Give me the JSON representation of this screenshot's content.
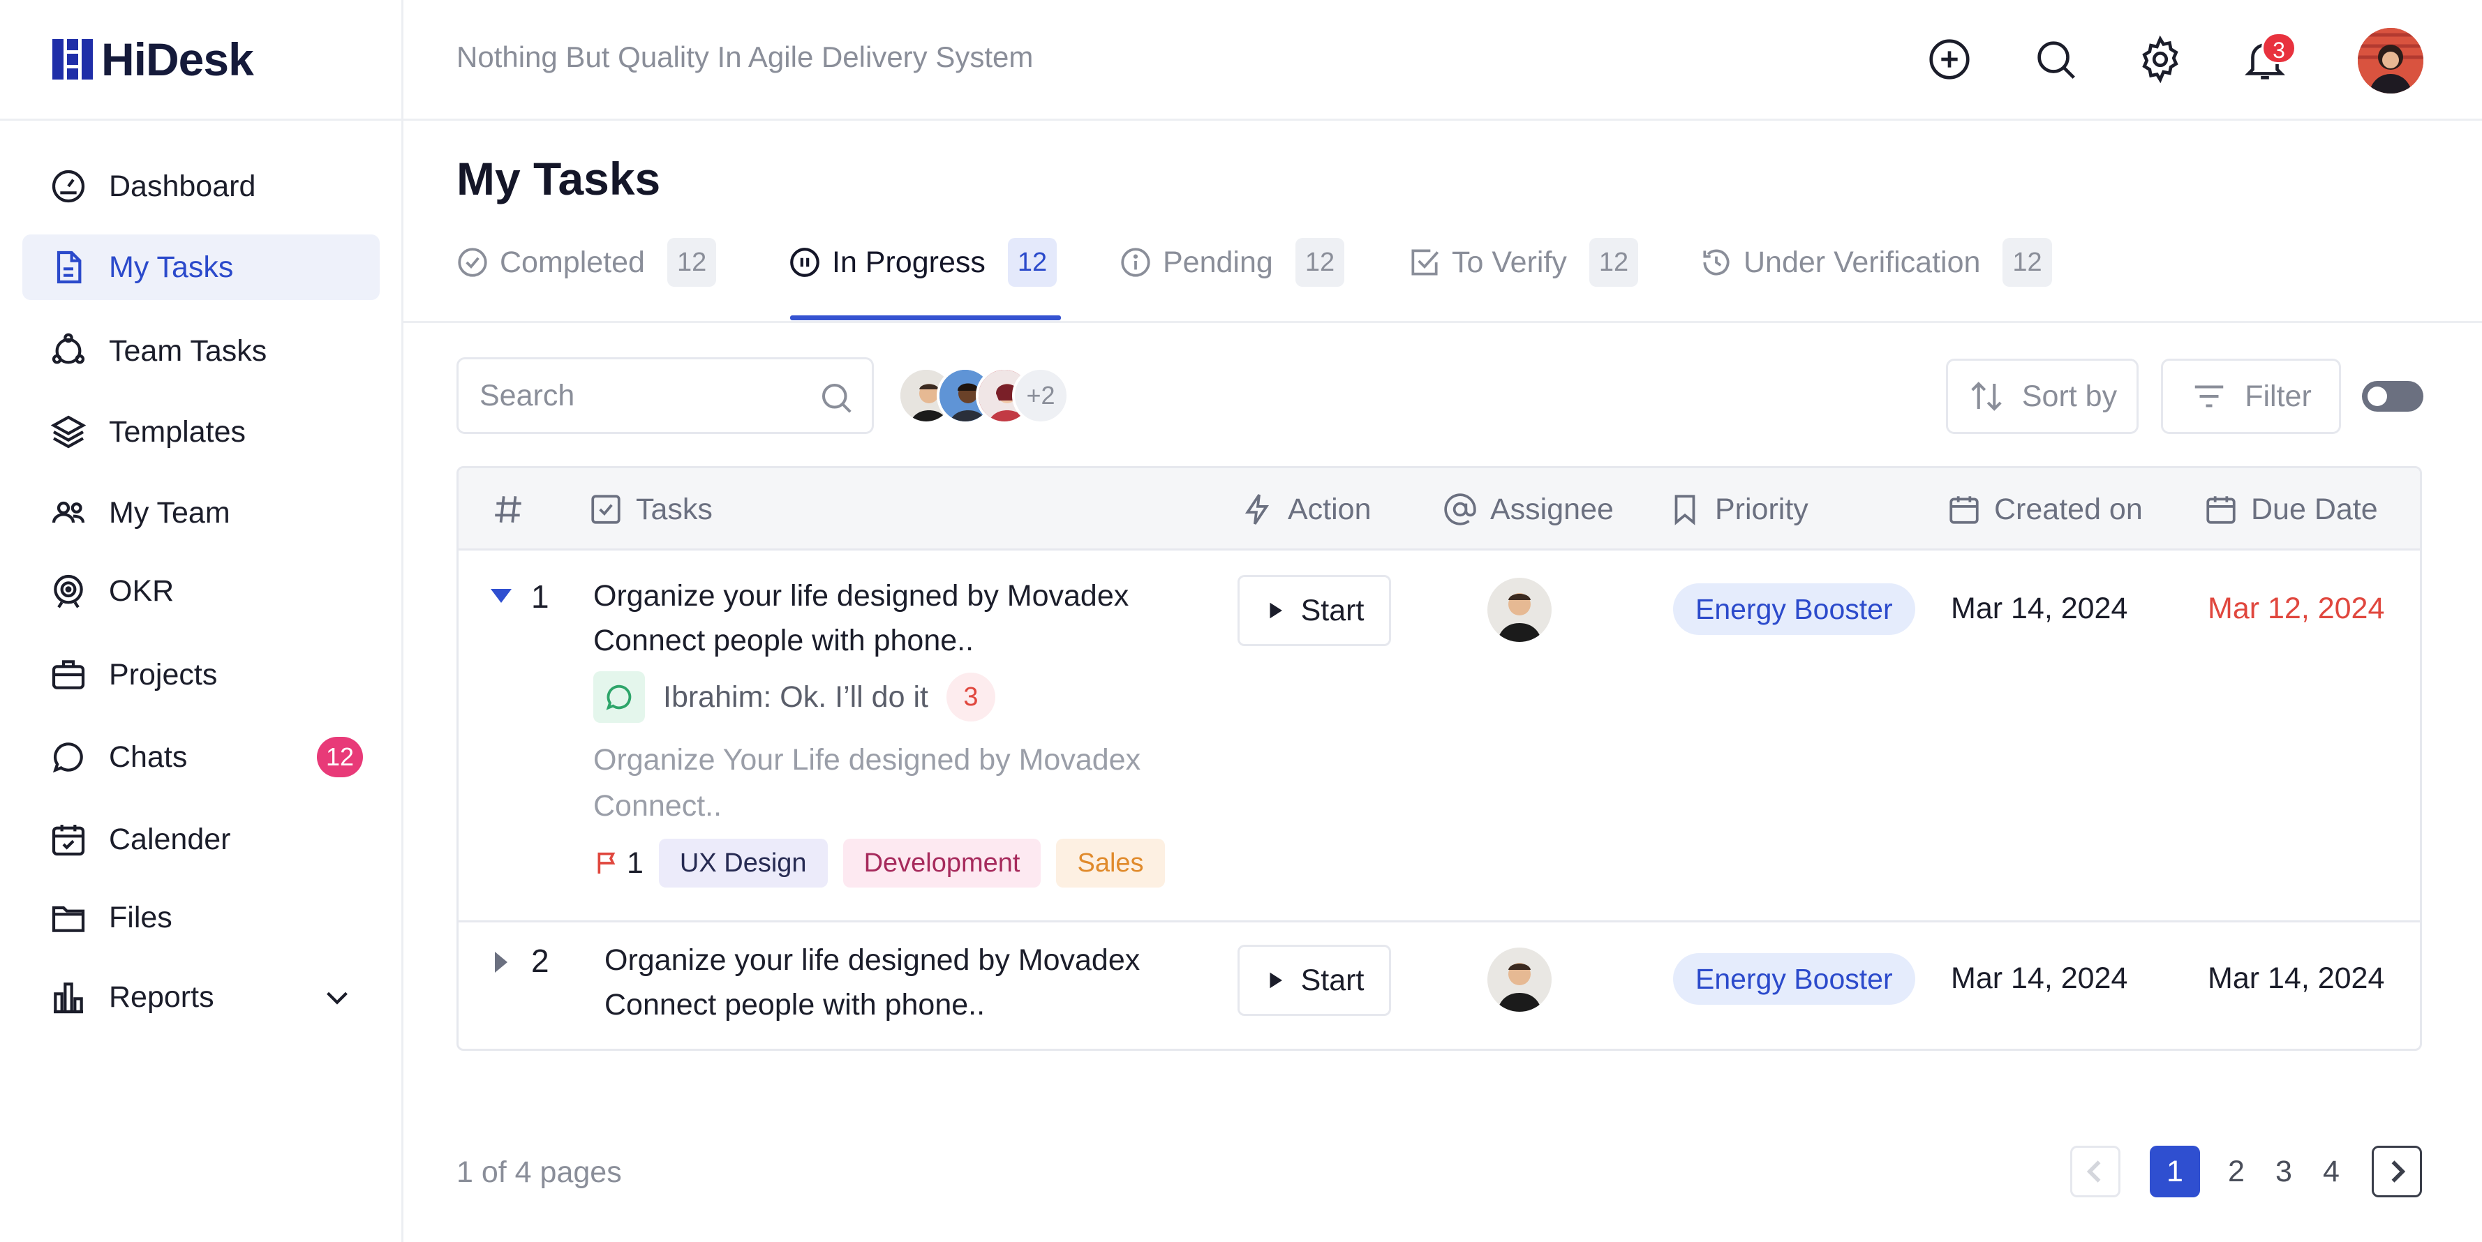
{
  "app": {
    "name": "HiDesk",
    "tagline": "Nothing But Quality In Agile Delivery System"
  },
  "header": {
    "notifications_count": "3"
  },
  "sidebar": {
    "items": [
      {
        "label": "Dashboard",
        "icon": "dashboard-icon"
      },
      {
        "label": "My Tasks",
        "icon": "document-icon",
        "active": true
      },
      {
        "label": "Team Tasks",
        "icon": "team-tasks-icon"
      },
      {
        "label": "Templates",
        "icon": "layers-icon"
      },
      {
        "label": "My Team",
        "icon": "users-icon"
      },
      {
        "label": "OKR",
        "icon": "target-icon"
      },
      {
        "label": "Projects",
        "icon": "briefcase-icon"
      },
      {
        "label": "Chats",
        "icon": "chat-icon",
        "badge": "12"
      },
      {
        "label": "Calender",
        "icon": "calendar-icon"
      },
      {
        "label": "Files",
        "icon": "folder-icon"
      },
      {
        "label": "Reports",
        "icon": "chart-icon"
      }
    ]
  },
  "page": {
    "title": "My Tasks"
  },
  "tabs": [
    {
      "label": "Completed",
      "count": "12",
      "icon": "check-circle-icon"
    },
    {
      "label": "In Progress",
      "count": "12",
      "icon": "pause-circle-icon",
      "active": true
    },
    {
      "label": "Pending",
      "count": "12",
      "icon": "info-icon"
    },
    {
      "label": "To Verify",
      "count": "12",
      "icon": "check-square-icon"
    },
    {
      "label": "Under Verification",
      "count": "12",
      "icon": "history-icon"
    }
  ],
  "toolbar": {
    "search_placeholder": "Search",
    "extra_members": "+2",
    "sort_label": "Sort by",
    "filter_label": "Filter"
  },
  "table": {
    "columns": [
      "Tasks",
      "Action",
      "Assignee",
      "Priority",
      "Created on",
      "Due Date"
    ],
    "rows": [
      {
        "num": "1",
        "title": "Organize your life designed by Movadex Connect people with phone..",
        "action": "Start",
        "priority": "Energy Booster",
        "created": "Mar 14, 2024",
        "due": "Mar 12, 2024",
        "chat": "Ibrahim: Ok. I’ll do it",
        "chat_count": "3",
        "description": "Organize Your Life designed by Movadex Connect..",
        "flag_count": "1",
        "tags": [
          "UX Design",
          "Development",
          "Sales"
        ]
      },
      {
        "num": "2",
        "title": "Organize your life designed by Movadex Connect people with phone..",
        "action": "Start",
        "priority": "Energy Booster",
        "created": "Mar 14, 2024",
        "due": "Mar 14, 2024"
      }
    ]
  },
  "pagination": {
    "info": "1 of 4 pages",
    "pages": [
      "1",
      "2",
      "3",
      "4"
    ],
    "current": "1"
  },
  "colors": {
    "accent": "#2f4fd0",
    "danger": "#e0473e",
    "badge": "#e83a78"
  }
}
